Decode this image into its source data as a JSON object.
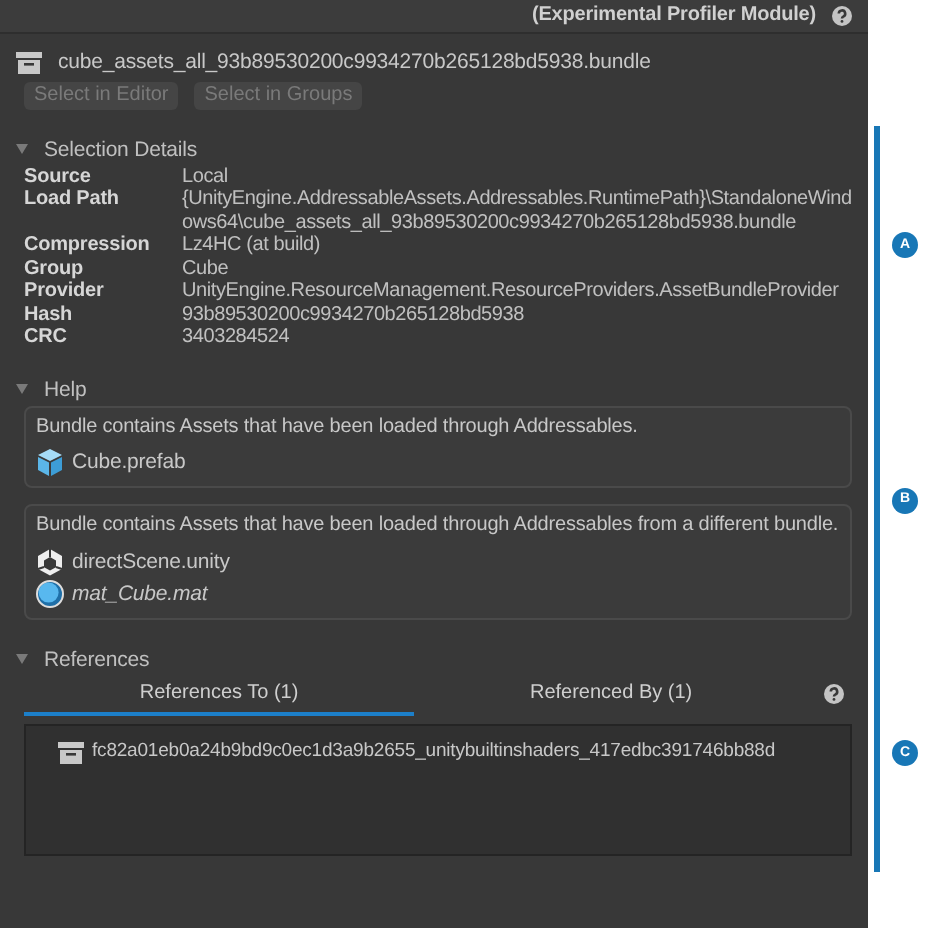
{
  "header": {
    "title": "(Experimental Profiler Module)"
  },
  "bundle": {
    "name": "cube_assets_all_93b89530200c9934270b265128bd5938.bundle"
  },
  "buttons": [
    {
      "label": "Select in Editor",
      "disabled": true
    },
    {
      "label": "Select in Groups",
      "disabled": true
    }
  ],
  "sections": [
    {
      "kind": "details",
      "title": "Selection Details",
      "expanded": true,
      "annotation": "A",
      "fields": [
        {
          "label": "Source",
          "value": "Local"
        },
        {
          "label": "Load Path",
          "value": "{UnityEngine.AddressableAssets.Addressables.RuntimePath}\\StandaloneWindows64\\cube_assets_all_93b89530200c9934270b265128bd5938.bundle"
        },
        {
          "label": "Compression",
          "value": "Lz4HC (at build)"
        },
        {
          "label": "Group",
          "value": "Cube"
        },
        {
          "label": "Provider",
          "value": "UnityEngine.ResourceManagement.ResourceProviders.AssetBundleProvider"
        },
        {
          "label": "Hash",
          "value": "93b89530200c9934270b265128bd5938"
        },
        {
          "label": "CRC",
          "value": "3403284524"
        }
      ]
    },
    {
      "kind": "help",
      "title": "Help",
      "expanded": true,
      "annotation": "B",
      "boxes": [
        {
          "message": "Bundle contains Assets that have been loaded through Addressables.",
          "assets": [
            {
              "kind": "prefab",
              "name": "Cube.prefab",
              "italic": false
            }
          ]
        },
        {
          "message": "Bundle contains Assets that have been loaded through Addressables from a different bundle.",
          "assets": [
            {
              "kind": "scene",
              "name": "directScene.unity",
              "italic": false
            },
            {
              "kind": "material",
              "name": "mat_Cube.mat",
              "italic": true
            }
          ]
        }
      ]
    },
    {
      "kind": "references",
      "title": "References",
      "expanded": true,
      "annotation": "C",
      "tabs": [
        {
          "label": "References To (1)",
          "selected": true
        },
        {
          "label": "Referenced By (1)",
          "selected": false
        }
      ],
      "items": [
        {
          "name": "fc82a01eb0a24b9bd9c0ec1d3a9b2655_unitybuiltinshaders_417edbc391746bb88d"
        }
      ]
    }
  ]
}
